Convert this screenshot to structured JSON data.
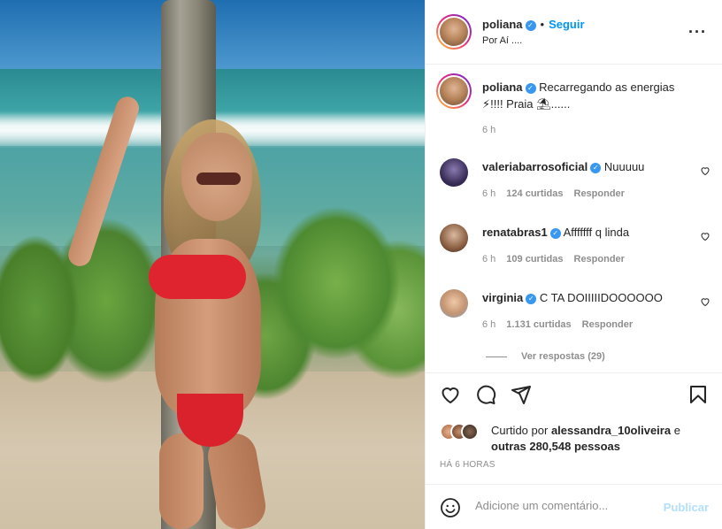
{
  "post": {
    "username": "poliana",
    "follow_label": "Seguir",
    "location": "Por Aí ....",
    "caption": "Recarregando as energias ⚡!!!! Praia ⛱......",
    "caption_time": "6 h"
  },
  "comments": [
    {
      "username": "valeriabarrosoficial",
      "text": "Nuuuuu",
      "time": "6 h",
      "likes": "124 curtidas",
      "reply": "Responder"
    },
    {
      "username": "renatabras1",
      "text": "Afffffff q linda",
      "time": "6 h",
      "likes": "109 curtidas",
      "reply": "Responder"
    },
    {
      "username": "virginia",
      "text": "C TA DOIIIIIDOOOOOO",
      "time": "6 h",
      "likes": "1.131 curtidas",
      "reply": "Responder"
    }
  ],
  "view_replies": "Ver respostas (29)",
  "likes": {
    "prefix": "Curtido por",
    "user": "alessandra_10oliveira",
    "and": "e",
    "others": "outras 280,548 pessoas"
  },
  "time_ago": "HÁ 6 HORAS",
  "add_comment": {
    "placeholder": "Adicione um comentário...",
    "publish": "Publicar"
  },
  "icons": {
    "more": "more-options-icon",
    "like": "heart-icon",
    "comment": "comment-icon",
    "share": "share-icon",
    "save": "bookmark-icon",
    "emoji": "emoji-icon",
    "verified": "verified-badge-icon"
  },
  "colors": {
    "accent": "#0095f6",
    "verified": "#3897f0",
    "publish_disabled": "#b2dffc",
    "muted": "#8e8e8e"
  }
}
